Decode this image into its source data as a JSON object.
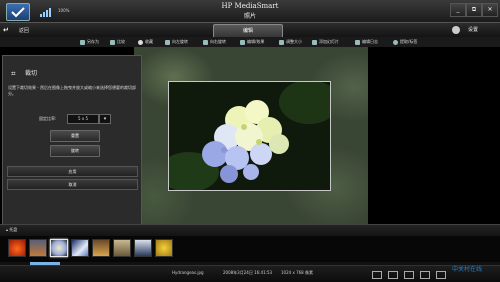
{
  "window": {
    "app_title": "HP MediaSmart",
    "section_title": "照片",
    "battery_text": "100%",
    "minimize_label": "_",
    "restore_label": "⧉",
    "close_label": "✕"
  },
  "nav": {
    "back_label": "返回",
    "edit_tab_label": "编辑",
    "settings_label": "设置"
  },
  "toolbar": {
    "items": [
      "另存为",
      "比较",
      "收藏",
      "向左旋转",
      "向右旋转",
      "编辑/效果",
      "调整大小",
      "添加幻灯片",
      "编辑日志",
      "提取/标签"
    ]
  },
  "crop_panel": {
    "title": "裁切",
    "description": "设置下裁切效果 - 然后在图像上拖曳并放大或缩小来选择您想要的裁切部分。",
    "ratio_label": "固定比率:",
    "ratio_value": "5 x 5",
    "reset_button": "重置",
    "rotate_button": "旋转",
    "apply_button": "应用",
    "cancel_button": "取消"
  },
  "filmstrip": {
    "label": "托盘",
    "selected_index": 2,
    "scroll_position": 0.06
  },
  "status": {
    "filename": "Hydrangeas.jpg",
    "datetime": "2008年3月24日 16:41:53",
    "dimensions": "1024 x 768 像素"
  },
  "watermark": "中关村在线"
}
